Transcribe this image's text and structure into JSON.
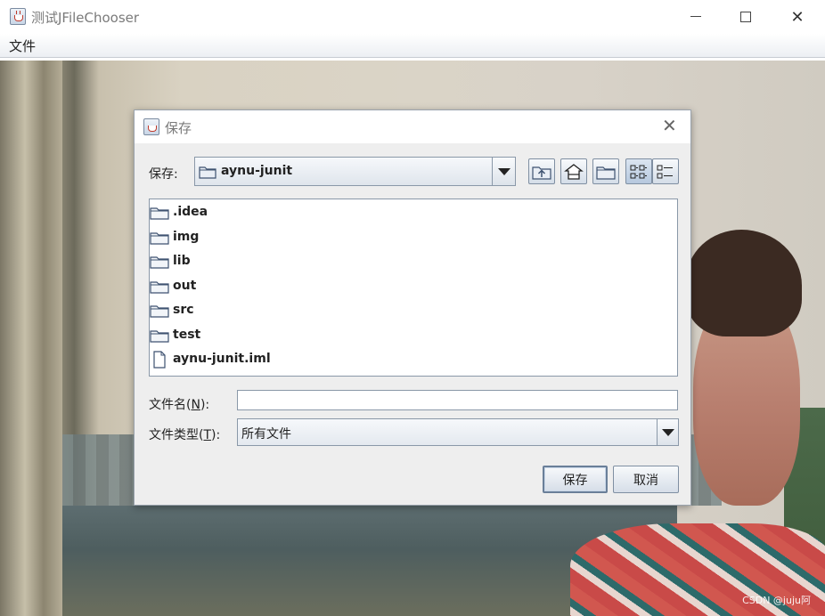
{
  "window": {
    "title": "测试JFileChooser",
    "menu": {
      "file": "文件"
    },
    "controls": {
      "minimize": "minimize",
      "maximize": "maximize",
      "close": "✕"
    }
  },
  "watermark": "CSDN @juju阿",
  "dialog": {
    "title": "保存",
    "close": "✕",
    "save_in_label": "保存:",
    "current_folder": "aynu-junit",
    "toolbar": [
      "up-one-level-icon",
      "home-icon",
      "new-folder-icon",
      "list-view-icon",
      "details-view-icon"
    ],
    "files": [
      {
        "name": ".idea",
        "icon": "folder-icon"
      },
      {
        "name": "img",
        "icon": "folder-icon"
      },
      {
        "name": "lib",
        "icon": "folder-icon"
      },
      {
        "name": "out",
        "icon": "folder-icon"
      },
      {
        "name": "src",
        "icon": "folder-icon"
      },
      {
        "name": "test",
        "icon": "folder-icon"
      },
      {
        "name": "aynu-junit.iml",
        "icon": "file-icon"
      }
    ],
    "file_name_label": {
      "text": "文件名(",
      "mnemonic": "N",
      "suffix": "):"
    },
    "file_name_value": "",
    "file_type_label": {
      "text": "文件类型(",
      "mnemonic": "T",
      "suffix": "):"
    },
    "file_type_value": "所有文件",
    "save_button": "保存",
    "cancel_button": "取消"
  }
}
